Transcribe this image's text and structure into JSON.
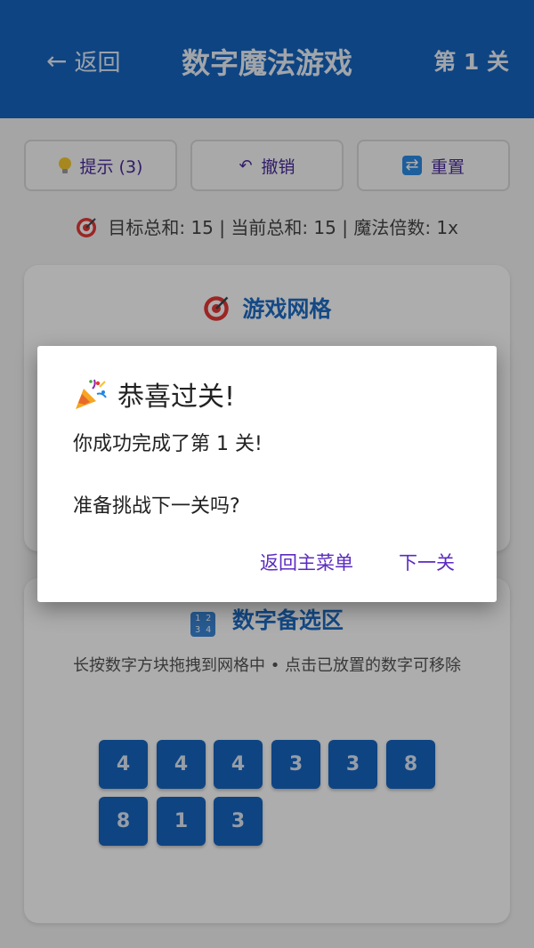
{
  "header": {
    "back_icon": "←",
    "back_label": "返回",
    "title": "数字魔法游戏",
    "level": "第 1 关"
  },
  "toolbar": {
    "hint_label": "提示 (3)",
    "undo_icon": "↶",
    "undo_label": "撤销",
    "reset_label": "重置"
  },
  "status": {
    "text": "目标总和: 15 | 当前总和: 15 | 魔法倍数: 1x"
  },
  "grid_card": {
    "title": "游戏网格"
  },
  "pool_card": {
    "icon_text_top": "1 2",
    "icon_text_bottom": "3 4",
    "title": "数字备选区",
    "hint": "长按数字方块拖拽到网格中 • 点击已放置的数字可移除",
    "tiles": [
      "4",
      "4",
      "4",
      "3",
      "3",
      "8",
      "8",
      "1",
      "3"
    ]
  },
  "dialog": {
    "title": "恭喜过关!",
    "line1": "你成功完成了第 1 关!",
    "line2": "准备挑战下一关吗?",
    "menu_button": "返回主菜单",
    "next_button": "下一关"
  },
  "colors": {
    "primary": "#1565c0",
    "accent": "#5b2bc0"
  }
}
